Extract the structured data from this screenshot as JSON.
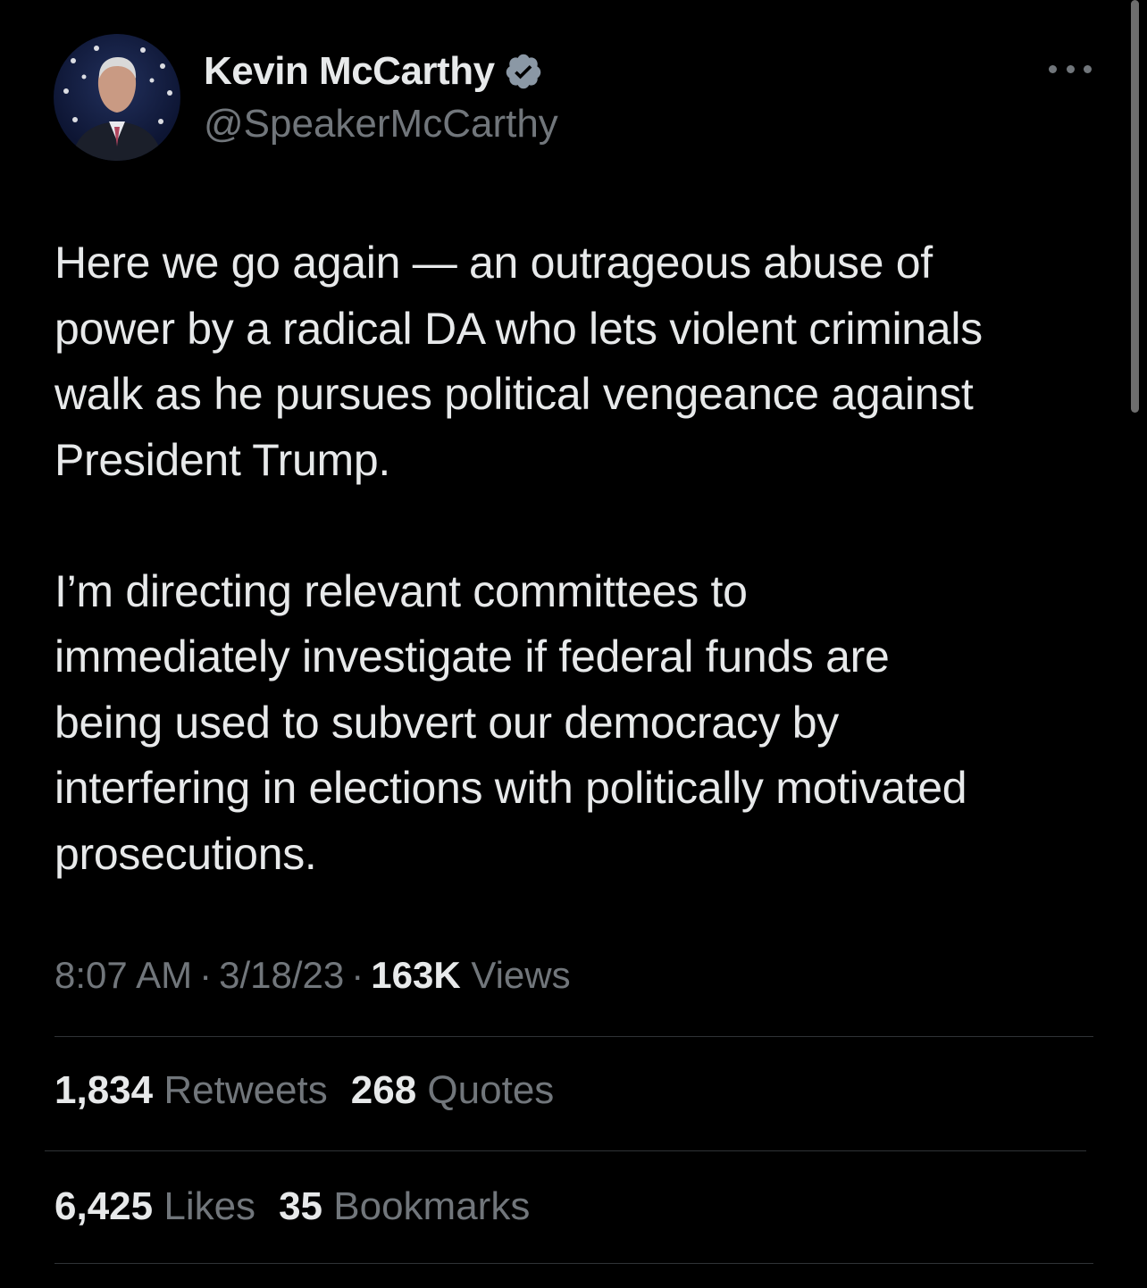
{
  "author": {
    "display_name": "Kevin McCarthy",
    "handle": "@SpeakerMcCarthy",
    "verified": true,
    "verified_color": "#8b98a5"
  },
  "tweet": {
    "text": "Here we go again — an outrageous abuse of\npower by a radical DA who lets violent criminals\nwalk as he pursues political vengeance against\nPresident Trump.\n\nI’m directing relevant committees to\nimmediately investigate if federal funds are\nbeing used to subvert our democracy by\ninterfering in elections with politically motivated\nprosecutions.",
    "time": "8:07 AM",
    "separator": "·",
    "date": "3/18/23",
    "views_count": "163K",
    "views_label": "Views"
  },
  "stats": {
    "retweets_count": "1,834",
    "retweets_label": "Retweets",
    "quotes_count": "268",
    "quotes_label": "Quotes",
    "likes_count": "6,425",
    "likes_label": "Likes",
    "bookmarks_count": "35",
    "bookmarks_label": "Bookmarks"
  },
  "colors": {
    "background": "#000000",
    "primary_text": "#e7e9ea",
    "secondary_text": "#71767b",
    "divider": "#2f3336"
  },
  "icons": {
    "more": "more-horizontal-icon",
    "verified": "verified-badge-icon"
  }
}
